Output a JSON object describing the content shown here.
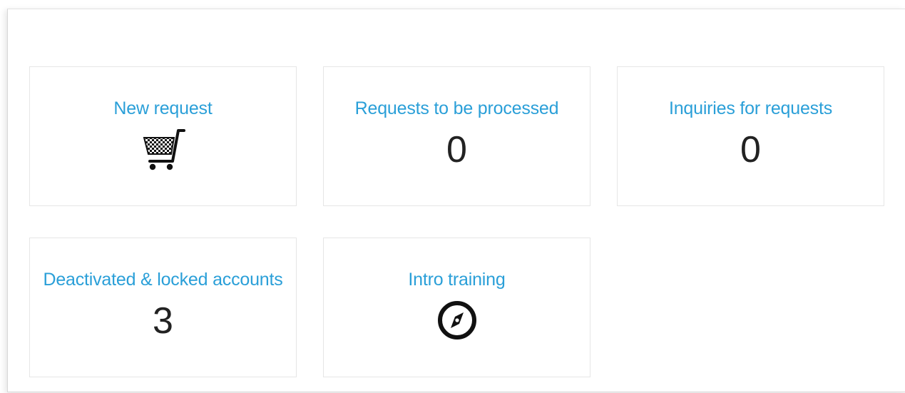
{
  "tiles": [
    {
      "title": "New request",
      "icon": "shopping-cart-icon"
    },
    {
      "title": "Requests to be processed",
      "count": "0"
    },
    {
      "title": "Inquiries for requests",
      "count": "0"
    },
    {
      "title": "Deactivated & locked accounts",
      "count": "3"
    },
    {
      "title": "Intro training",
      "icon": "compass-icon"
    }
  ],
  "colors": {
    "link": "#2a9fd8",
    "count": "#222222",
    "tile_border": "#e6e6e6"
  }
}
